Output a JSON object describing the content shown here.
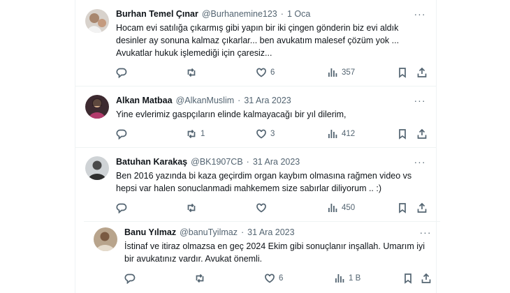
{
  "tweets": [
    {
      "name": "Burhan Temel Çınar",
      "handle": "@Burhanemine123",
      "sep": "·",
      "date": "1 Oca",
      "text": "Hocam evi satılığa çıkarmış gibi yapın bir iki çingen gönderin biz evi aldık desinler ay sonuna kalmaz çıkarlar... ben avukatım malesef çözüm yok ... Avukatlar hukuk işlemediği için çaresiz...",
      "retweets": "",
      "likes": "6",
      "views": "357"
    },
    {
      "name": "Alkan Matbaa",
      "handle": "@AlkanMuslim",
      "sep": "·",
      "date": "31 Ara 2023",
      "text": "Yine evlerimiz gaspçıların elinde kalmayacağı bir yıl dilerim,",
      "retweets": "1",
      "likes": "3",
      "views": "412"
    },
    {
      "name": "Batuhan Karakaş",
      "handle": "@BK1907CB",
      "sep": "·",
      "date": "31 Ara 2023",
      "text": "Ben 2016 yazında bi kaza geçirdim organ kaybım olmasına rağmen video vs hepsi var halen sonuclanmadi mahkemem size sabırlar diliyorum .. :)",
      "retweets": "",
      "likes": "",
      "views": "450"
    },
    {
      "name": "Banu Yılmaz",
      "handle": "@banuTyilmaz",
      "sep": "·",
      "date": "31 Ara 2023",
      "text": "İstinaf ve itiraz olmazsa en geç 2024 Ekim gibi sonuçlanır inşallah. Umarım iyi bir avukatınız vardır. Avukat önemli.",
      "retweets": "",
      "likes": "6",
      "views": "1 B"
    }
  ],
  "icons": {
    "more": "more-icon",
    "reply": "reply-icon",
    "retweet": "retweet-icon",
    "like": "like-icon",
    "views": "views-icon",
    "bookmark": "bookmark-icon",
    "share": "share-icon"
  },
  "colors": {
    "text": "#0f1419",
    "muted": "#536471",
    "border": "#eff3f4"
  }
}
